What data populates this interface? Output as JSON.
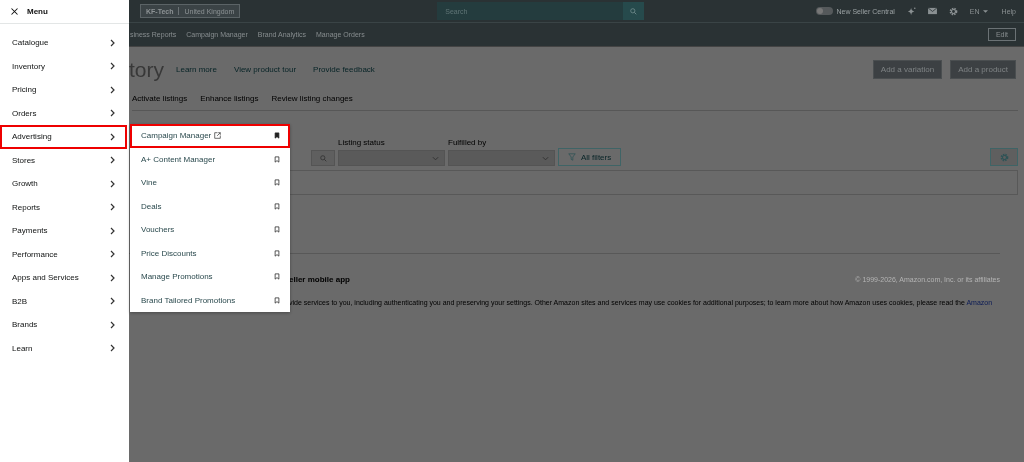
{
  "menu": {
    "title": "Menu",
    "items": [
      {
        "label": "Catalogue",
        "selected": false
      },
      {
        "label": "Inventory",
        "selected": false
      },
      {
        "label": "Pricing",
        "selected": false
      },
      {
        "label": "Orders",
        "selected": false
      },
      {
        "label": "Advertising",
        "selected": true
      },
      {
        "label": "Stores",
        "selected": false
      },
      {
        "label": "Growth",
        "selected": false
      },
      {
        "label": "Reports",
        "selected": false
      },
      {
        "label": "Payments",
        "selected": false
      },
      {
        "label": "Performance",
        "selected": false
      },
      {
        "label": "Apps and Services",
        "selected": false
      },
      {
        "label": "B2B",
        "selected": false
      },
      {
        "label": "Brands",
        "selected": false
      },
      {
        "label": "Learn",
        "selected": false
      }
    ]
  },
  "submenu": {
    "items": [
      {
        "label": "Campaign Manager",
        "external": true,
        "pinned": true,
        "selected": true
      },
      {
        "label": "A+ Content Manager",
        "external": false,
        "pinned": false,
        "selected": false
      },
      {
        "label": "Vine",
        "external": false,
        "pinned": false,
        "selected": false
      },
      {
        "label": "Deals",
        "external": false,
        "pinned": false,
        "selected": false
      },
      {
        "label": "Vouchers",
        "external": false,
        "pinned": false,
        "selected": false
      },
      {
        "label": "Price Discounts",
        "external": false,
        "pinned": false,
        "selected": false
      },
      {
        "label": "Manage Promotions",
        "external": false,
        "pinned": false,
        "selected": false
      },
      {
        "label": "Brand Tailored Promotions",
        "external": false,
        "pinned": false,
        "selected": false
      }
    ]
  },
  "top_bar": {
    "account": "KF-Tech",
    "marketplace": "United Kingdom",
    "search": {
      "placeholder": "Search"
    },
    "toggle": {
      "label": "New Seller Central",
      "on": false
    },
    "language": "EN",
    "help": "Help"
  },
  "nav_bar": {
    "links": [
      "siness Reports",
      "Campaign Manager",
      "Brand Analytics",
      "Manage Orders"
    ],
    "edit": "Edit"
  },
  "page": {
    "title": "tory",
    "links": [
      "Learn more",
      "View product tour",
      "Provide feedback"
    ],
    "buttons": [
      "Add a variation",
      "Add a product"
    ],
    "tabs": [
      "Activate listings",
      "Enhance listings",
      "Review listing changes"
    ],
    "filters": [
      {
        "label": "Listing status"
      },
      {
        "label": "Fulfilled by"
      }
    ],
    "all_filters": "All filters"
  },
  "footer": {
    "app_link": "eller mobile app",
    "copyright": "© 1999-2026, Amazon.com, Inc. or its affiliates",
    "cookie_notice": "vide services to you, including authenticating you and preserving your settings. Other Amazon sites and services may use cookies for additional purposes; to learn more about how Amazon uses cookies, please read the",
    "cookie_link": "Amazon"
  }
}
